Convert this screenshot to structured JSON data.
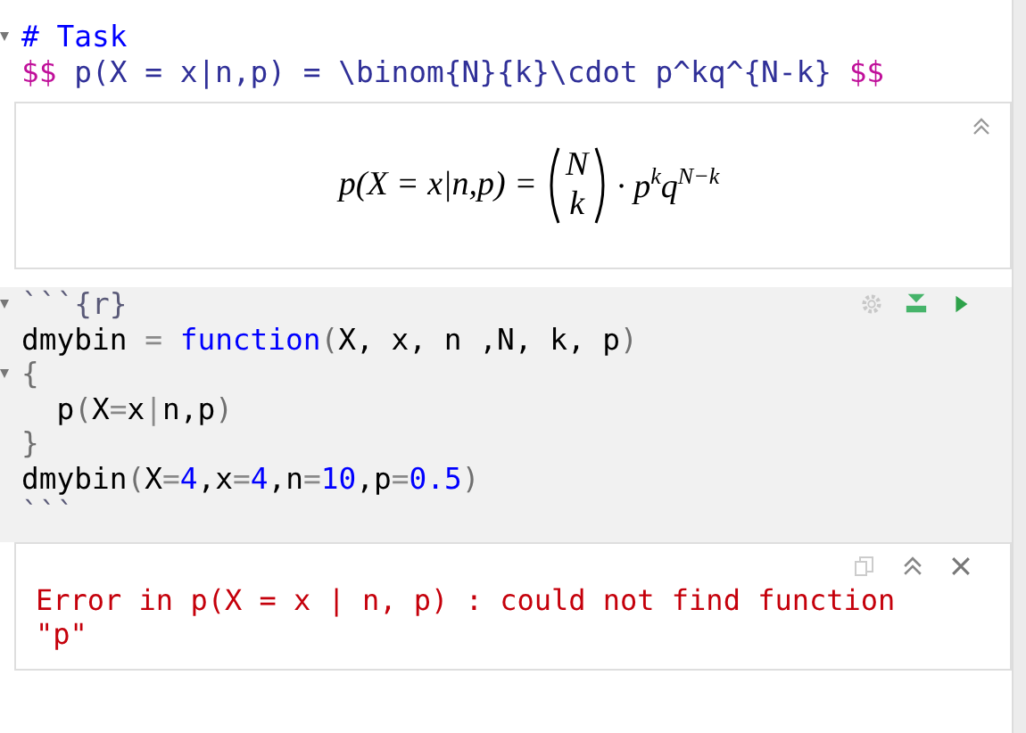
{
  "markdown_lines": [
    {
      "fold": true,
      "tokens": [
        {
          "kind": "heading",
          "text": "# Task"
        }
      ]
    },
    {
      "fold": false,
      "tokens": [
        {
          "kind": "delim",
          "text": "$$"
        },
        {
          "kind": "math",
          "text": " p(X = x|n,p) = \\binom{N}{k}\\cdot p^kq^{N-k} "
        },
        {
          "kind": "delim",
          "text": "$$"
        }
      ]
    }
  ],
  "math_output": {
    "lhs": "p(X = x|n,p) =",
    "binom_top": "N",
    "binom_bottom": "k",
    "rest": "· p$^{k}$q$^{N−k}$"
  },
  "chunk": {
    "lines": [
      {
        "fold": true,
        "tokens": [
          {
            "kind": "fence",
            "text": "```{r}"
          }
        ]
      },
      {
        "fold": false,
        "tokens": [
          {
            "kind": "text",
            "text": "dmybin"
          },
          {
            "kind": "op",
            "text": " = "
          },
          {
            "kind": "keyword",
            "text": "function"
          },
          {
            "kind": "paren",
            "text": "("
          },
          {
            "kind": "text",
            "text": "X, x, n ,N, k, p"
          },
          {
            "kind": "paren",
            "text": ")"
          }
        ]
      },
      {
        "fold": true,
        "tokens": [
          {
            "kind": "paren",
            "text": "{"
          }
        ]
      },
      {
        "fold": false,
        "tokens": [
          {
            "kind": "text",
            "text": "  p"
          },
          {
            "kind": "paren",
            "text": "("
          },
          {
            "kind": "text",
            "text": "X"
          },
          {
            "kind": "op",
            "text": "="
          },
          {
            "kind": "text",
            "text": "x"
          },
          {
            "kind": "op",
            "text": "|"
          },
          {
            "kind": "text",
            "text": "n,p"
          },
          {
            "kind": "paren",
            "text": ")"
          }
        ]
      },
      {
        "fold": false,
        "tokens": [
          {
            "kind": "paren",
            "text": "}"
          }
        ]
      },
      {
        "fold": false,
        "tokens": [
          {
            "kind": "text",
            "text": "dmybin"
          },
          {
            "kind": "paren",
            "text": "("
          },
          {
            "kind": "text",
            "text": "X"
          },
          {
            "kind": "op",
            "text": "="
          },
          {
            "kind": "number",
            "text": "4"
          },
          {
            "kind": "text",
            "text": ",x"
          },
          {
            "kind": "op",
            "text": "="
          },
          {
            "kind": "number",
            "text": "4"
          },
          {
            "kind": "text",
            "text": ",n"
          },
          {
            "kind": "op",
            "text": "="
          },
          {
            "kind": "number",
            "text": "10"
          },
          {
            "kind": "text",
            "text": ",p"
          },
          {
            "kind": "op",
            "text": "="
          },
          {
            "kind": "number",
            "text": "0.5"
          },
          {
            "kind": "paren",
            "text": ")"
          }
        ]
      },
      {
        "fold": false,
        "tokens": [
          {
            "kind": "fence",
            "text": "```"
          }
        ]
      }
    ]
  },
  "error_output": {
    "text": "Error in p(X = x | n, p) : could not find function \"p\""
  }
}
